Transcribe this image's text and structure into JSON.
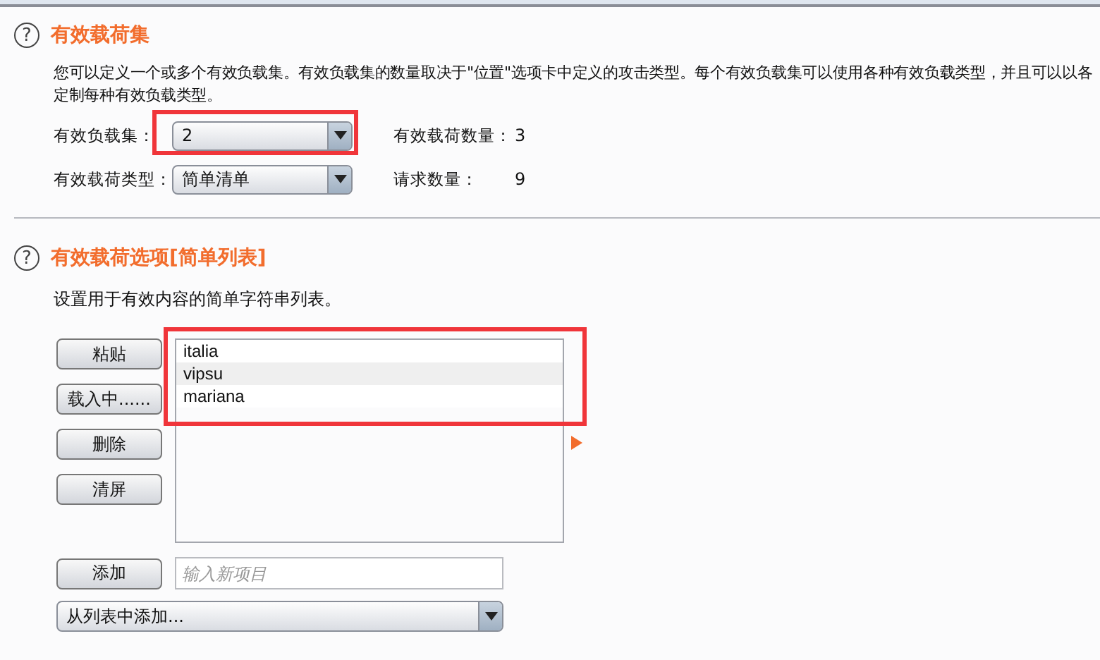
{
  "payload_sets": {
    "help_icon": "?",
    "title": "有效载荷集",
    "description_lines": [
      "您可以定义一个或多个有效负载集。有效负载集的数量取决于\"位置\"选项卡中定义的攻击类型。每个有效负载集可以使用各种有效负载类型，并且可以以各",
      "定制每种有效负载类型。"
    ],
    "fields": [
      {
        "label": "有效负载集：",
        "value": "2",
        "stat_label": "有效载荷数量：",
        "stat_value": "3"
      },
      {
        "label": "有效载荷类型：",
        "value": "简单清单",
        "stat_label": "请求数量：",
        "stat_value": "9"
      }
    ],
    "first_dropdown_highlighted": true
  },
  "payload_options": {
    "help_icon": "?",
    "title": "有效载荷选项[简单列表]",
    "description": "设置用于有效内容的简单字符串列表。",
    "buttons": [
      "粘贴",
      "载入中......",
      "删除",
      "清屏"
    ],
    "list_highlighted": true,
    "items": [
      "italia",
      "vipsu",
      "mariana"
    ],
    "add_button": "添加",
    "new_item": {
      "placeholder": "输入新项目"
    },
    "add_from_list": "从列表中添加..."
  }
}
